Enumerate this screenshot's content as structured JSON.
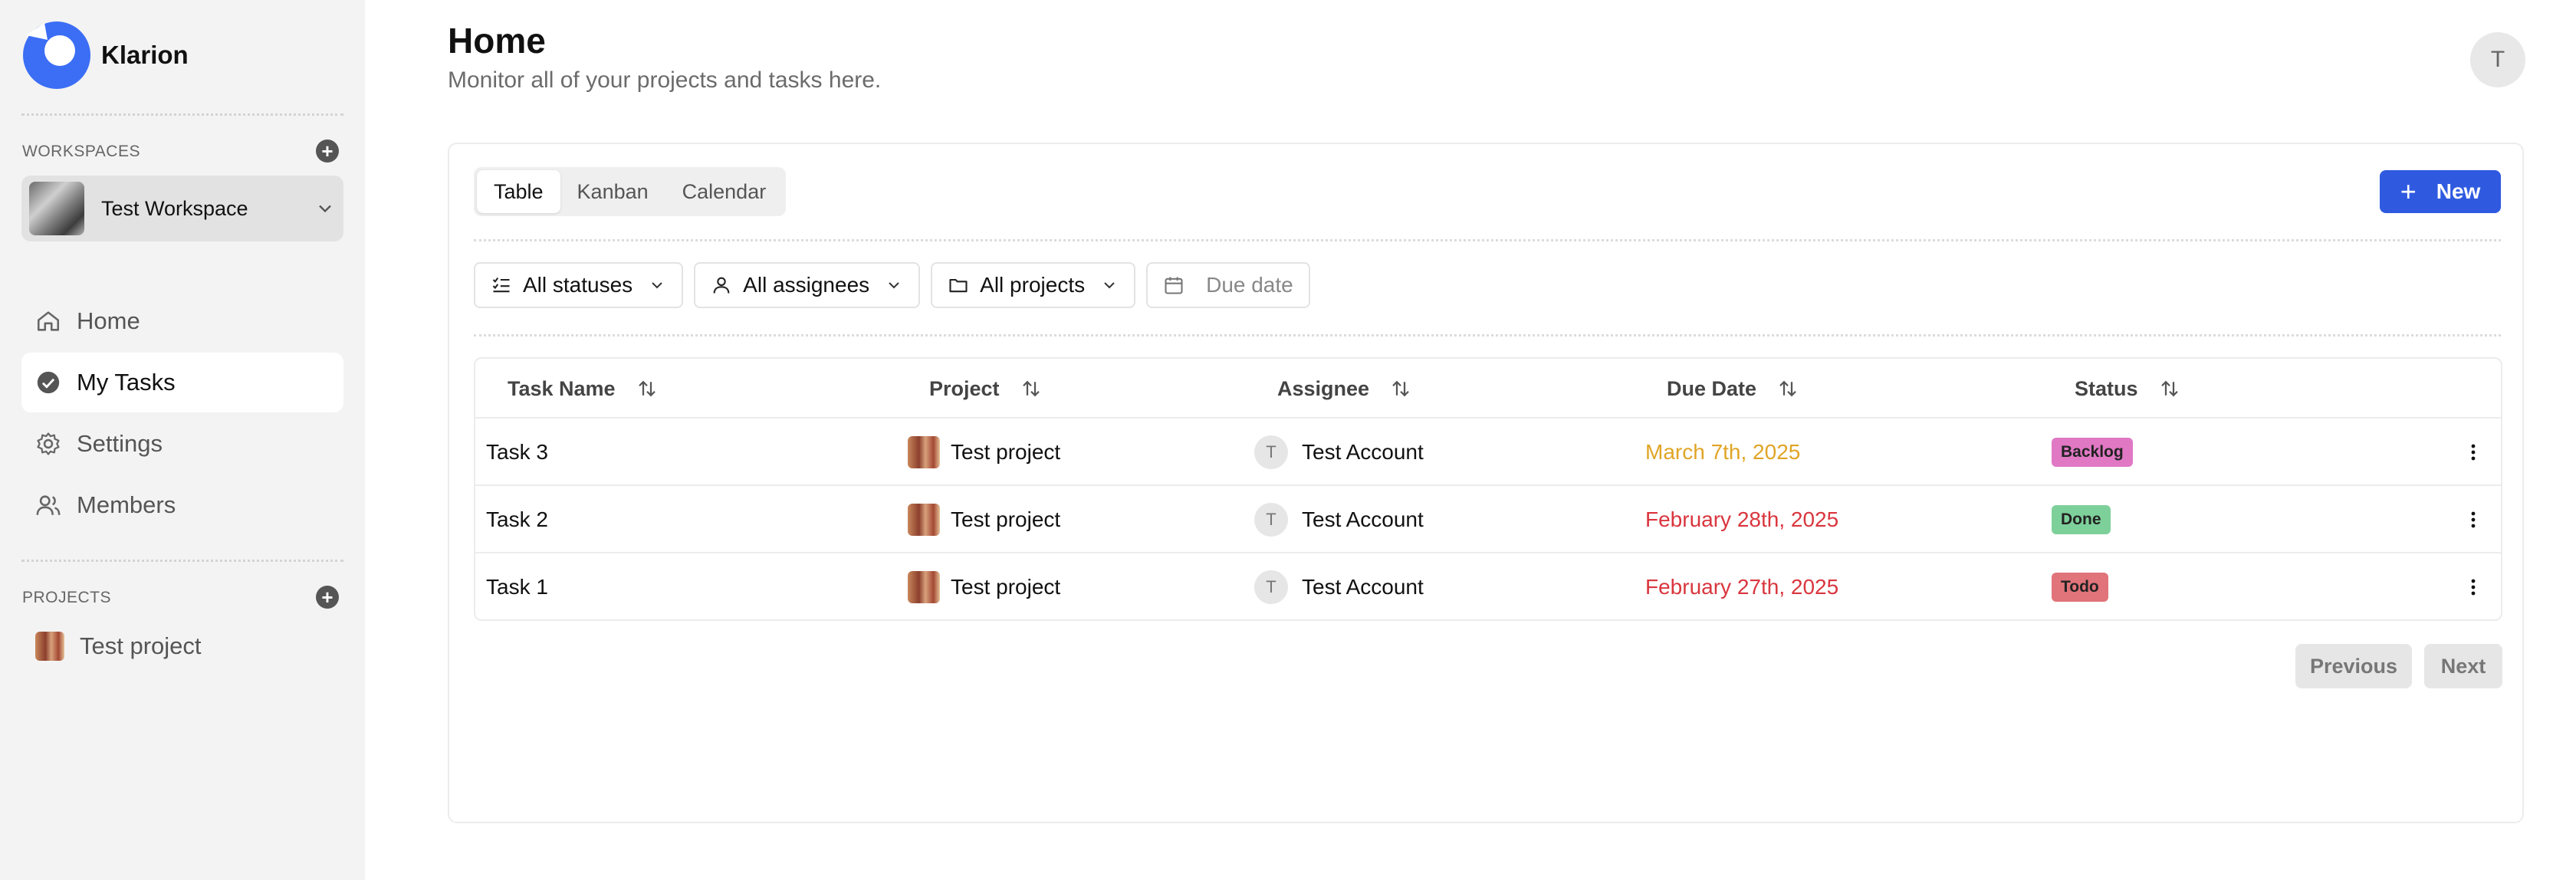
{
  "app": {
    "name": "Klarion"
  },
  "sidebar": {
    "workspaces_label": "WORKSPACES",
    "workspace": {
      "name": "Test Workspace"
    },
    "nav": [
      {
        "label": "Home",
        "icon": "home-icon"
      },
      {
        "label": "My Tasks",
        "icon": "check-circle-icon",
        "active": true
      },
      {
        "label": "Settings",
        "icon": "gear-icon"
      },
      {
        "label": "Members",
        "icon": "users-icon"
      }
    ],
    "projects_label": "PROJECTS",
    "projects": [
      {
        "name": "Test project"
      }
    ]
  },
  "header": {
    "title": "Home",
    "subtitle": "Monitor all of your projects and tasks here.",
    "avatar_initial": "T"
  },
  "view_tabs": [
    {
      "label": "Table",
      "active": true
    },
    {
      "label": "Kanban"
    },
    {
      "label": "Calendar"
    }
  ],
  "new_button": {
    "label": "New"
  },
  "filters": {
    "status": "All statuses",
    "assignee": "All assignees",
    "project": "All projects",
    "due_date_placeholder": "Due date"
  },
  "table": {
    "columns": [
      "Task Name",
      "Project",
      "Assignee",
      "Due Date",
      "Status"
    ],
    "rows": [
      {
        "task": "Task 3",
        "project": "Test project",
        "assignee": "Test Account",
        "assignee_initial": "T",
        "due": "March 7th, 2025",
        "due_color": "#e0a526",
        "status": "Backlog",
        "status_color": "#e078c4"
      },
      {
        "task": "Task 2",
        "project": "Test project",
        "assignee": "Test Account",
        "assignee_initial": "T",
        "due": "February 28th, 2025",
        "due_color": "#d9363e",
        "status": "Done",
        "status_color": "#7ed09a"
      },
      {
        "task": "Task 1",
        "project": "Test project",
        "assignee": "Test Account",
        "assignee_initial": "T",
        "due": "February 27th, 2025",
        "due_color": "#d9363e",
        "status": "Todo",
        "status_color": "#e0747a"
      }
    ]
  },
  "pagination": {
    "previous": "Previous",
    "next": "Next"
  },
  "colors": {
    "accent": "#2f5ae0",
    "sidebar_bg": "#f3f3f3"
  }
}
